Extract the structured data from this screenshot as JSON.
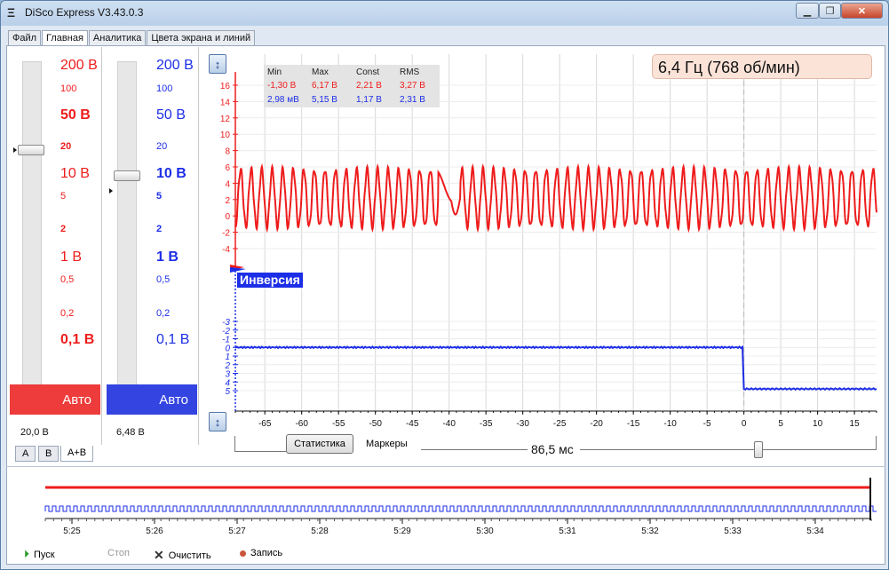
{
  "window": {
    "title": "DiSco Express V3.43.0.3",
    "minimize": "▁",
    "restore": "❐",
    "close": "✕"
  },
  "tabs": [
    "Файл",
    "Главная",
    "Аналитика",
    "Цвета экрана и линий"
  ],
  "channel_a": {
    "labels": [
      "200 В",
      "100",
      "50 В",
      "20",
      "10 В",
      "5",
      "2",
      "1 В",
      "0,5",
      "0,2",
      "0,1 В"
    ],
    "auto": "Авто",
    "value": "20,0 В",
    "color": "#ee1c1c"
  },
  "channel_b": {
    "labels": [
      "200 В",
      "100",
      "50 В",
      "20",
      "10 В",
      "5",
      "2",
      "1 В",
      "0,5",
      "0,2",
      "0,1 В"
    ],
    "auto": "Авто",
    "value": "6,48 В",
    "color": "#1c2ee6"
  },
  "channel_tabs": [
    "A",
    "B",
    "A+B"
  ],
  "frequency": "6,4 Гц (768 об/мин)",
  "stats": {
    "headers": [
      "Min",
      "Max",
      "Const",
      "RMS"
    ],
    "row_a": [
      "-1,30 В",
      "6,17 В",
      "2,21 В",
      "3,27 В"
    ],
    "row_b": [
      "2,98 мВ",
      "5,15 В",
      "1,17 В",
      "2,31 В"
    ]
  },
  "inversion_label": "Инверсия",
  "chart_data": {
    "type": "line",
    "x_ticks": [
      "-65",
      "-60",
      "-55",
      "-50",
      "-45",
      "-40",
      "-35",
      "-30",
      "-25",
      "-20",
      "-15",
      "-10",
      "-5",
      "0",
      "5",
      "10",
      "15"
    ],
    "xlim": [
      -69,
      18
    ],
    "y_axis_a": {
      "ticks": [
        "16",
        "14",
        "12",
        "10",
        "8",
        "6",
        "4",
        "2",
        "0",
        "-2",
        "-4"
      ],
      "ylim": [
        -5,
        17
      ],
      "color": "#ee1c1c"
    },
    "y_axis_b": {
      "ticks": [
        "-3",
        "-2",
        "-1",
        "0",
        "1",
        "2",
        "3",
        "4",
        "5"
      ],
      "ylim": [
        -3.5,
        5.8
      ],
      "color": "#1c2ee6"
    },
    "series": [
      {
        "color": "#ee1c1c",
        "kind": "oscillation",
        "center": 2.2,
        "amplitude": 3.5,
        "period_ms": 1.43,
        "gap_start": -41.5,
        "gap_end": -38.5
      },
      {
        "color": "#1c2ee6",
        "kind": "step",
        "x": [
          -69,
          0,
          0,
          18
        ],
        "y": [
          0,
          0,
          4.8,
          4.8
        ]
      }
    ],
    "cursor_x": 0
  },
  "toolbar": {
    "stats_button": "Статистика",
    "markers": "Маркеры",
    "timebase": "86,5 мс"
  },
  "timeline": {
    "ticks": [
      "5:25",
      "5:26",
      "5:27",
      "5:28",
      "5:29",
      "5:30",
      "5:31",
      "5:32",
      "5:33",
      "5:34"
    ]
  },
  "footer": {
    "start": "Пуск",
    "stop": "Стоп",
    "clear": "Очистить",
    "record": "Запись"
  }
}
